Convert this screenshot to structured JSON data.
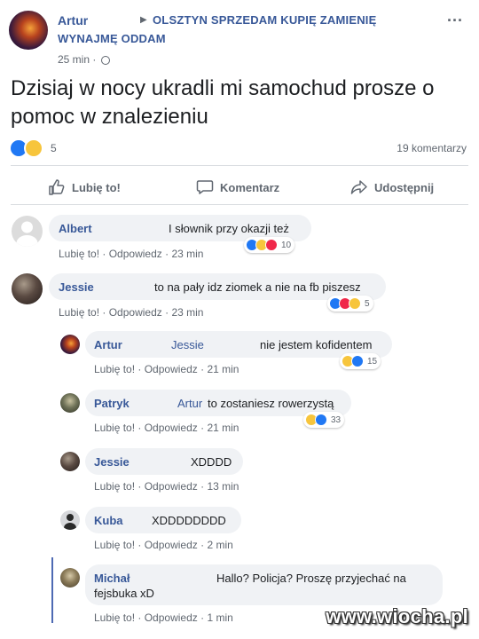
{
  "post": {
    "author": "Artur",
    "group_line1": "OLSZTYN SPRZEDAM KUPIĘ ZAMIENIĘ",
    "group_line2": "WYNAJMĘ ODDAM",
    "time": "25 min ·",
    "more_icon": "...",
    "text": "Dzisiaj w nocy ukradli mi samochud prosze o pomoc w znalezieniu",
    "reactions": [
      "like",
      "haha"
    ],
    "reaction_count": "5",
    "comment_count": "19 komentarzy"
  },
  "actions": {
    "like": "Lubię to!",
    "comment": "Komentarz",
    "share": "Udostępnij"
  },
  "comments": [
    {
      "name": "Albert",
      "text": "I słownik przy okazji też",
      "like": "Lubię to!",
      "reply": "Odpowiedz",
      "time": "23 min",
      "reactions": [
        "like",
        "haha",
        "love"
      ],
      "count": "10"
    },
    {
      "name": "Jessie",
      "text": "to na pały idz ziomek a nie na fb piszesz",
      "like": "Lubię to!",
      "reply": "Odpowiedz",
      "time": "23 min",
      "reactions": [
        "like",
        "love",
        "haha"
      ],
      "count": "5"
    },
    {
      "name": "Artur",
      "mention": "Jessie",
      "text": "nie jestem kofidentem",
      "like": "Lubię to!",
      "reply": "Odpowiedz",
      "time": "21 min",
      "reactions": [
        "haha",
        "like"
      ],
      "count": "15"
    },
    {
      "name": "Patryk",
      "mention": "Artur",
      "text": "to zostaniesz rowerzystą",
      "like": "Lubię to!",
      "reply": "Odpowiedz",
      "time": "21 min",
      "reactions": [
        "haha",
        "like"
      ],
      "count": "33"
    },
    {
      "name": "Jessie",
      "text": "XDDDD",
      "like": "Lubię to!",
      "reply": "Odpowiedz",
      "time": "13 min"
    },
    {
      "name": "Kuba",
      "text": "XDDDDDDDD",
      "like": "Lubię to!",
      "reply": "Odpowiedz",
      "time": "2 min"
    },
    {
      "name": "Michał",
      "text_line1": "Hallo? Policja? Proszę przyjechać na",
      "text_line2": "fejsbuka xD",
      "like": "Lubię to!",
      "reply": "Odpowiedz",
      "time": "1 min"
    }
  ],
  "watermark": "www.wiocha.pl",
  "colors": {
    "link": "#385898",
    "bubble": "#f0f2f5",
    "muted": "#606770",
    "like": "#2078f4",
    "haha": "#f7c53c",
    "love": "#f0284a"
  }
}
